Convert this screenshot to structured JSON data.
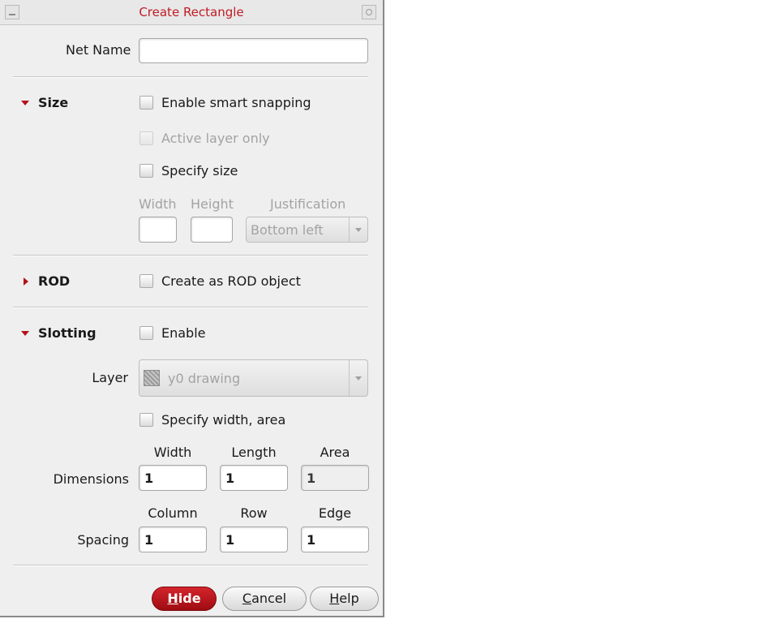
{
  "window": {
    "title": "Create Rectangle",
    "accent_color": "#c01c24"
  },
  "net_name": {
    "label": "Net Name",
    "value": ""
  },
  "size": {
    "section_label": "Size",
    "expanded": true,
    "enable_smart_snapping": {
      "label": "Enable smart snapping",
      "checked": false
    },
    "active_layer_only": {
      "label": "Active layer only",
      "checked": false,
      "disabled": true
    },
    "specify_size": {
      "label": "Specify size",
      "checked": false
    },
    "width": {
      "label": "Width",
      "value": ""
    },
    "height": {
      "label": "Height",
      "value": ""
    },
    "justification": {
      "label": "Justification",
      "selected": "Bottom left"
    }
  },
  "rod": {
    "section_label": "ROD",
    "expanded": false,
    "create_as_rod": {
      "label": "Create as ROD object",
      "checked": false
    }
  },
  "slotting": {
    "section_label": "Slotting",
    "expanded": true,
    "enable": {
      "label": "Enable",
      "checked": false
    },
    "layer": {
      "label": "Layer",
      "selected": "y0 drawing"
    },
    "specify_width_area": {
      "label": "Specify width, area",
      "checked": false
    },
    "dimensions": {
      "row_label": "Dimensions",
      "width": {
        "label": "Width",
        "value": "1"
      },
      "length": {
        "label": "Length",
        "value": "1"
      },
      "area": {
        "label": "Area",
        "value": "1"
      }
    },
    "spacing": {
      "row_label": "Spacing",
      "column": {
        "label": "Column",
        "value": "1"
      },
      "row": {
        "label": "Row",
        "value": "1"
      },
      "edge": {
        "label": "Edge",
        "value": "1"
      }
    }
  },
  "buttons": {
    "hide": {
      "mnemonic": "H",
      "rest": "ide"
    },
    "cancel": {
      "mnemonic": "C",
      "rest": "ancel"
    },
    "help": {
      "mnemonic": "H",
      "rest": "elp"
    }
  }
}
